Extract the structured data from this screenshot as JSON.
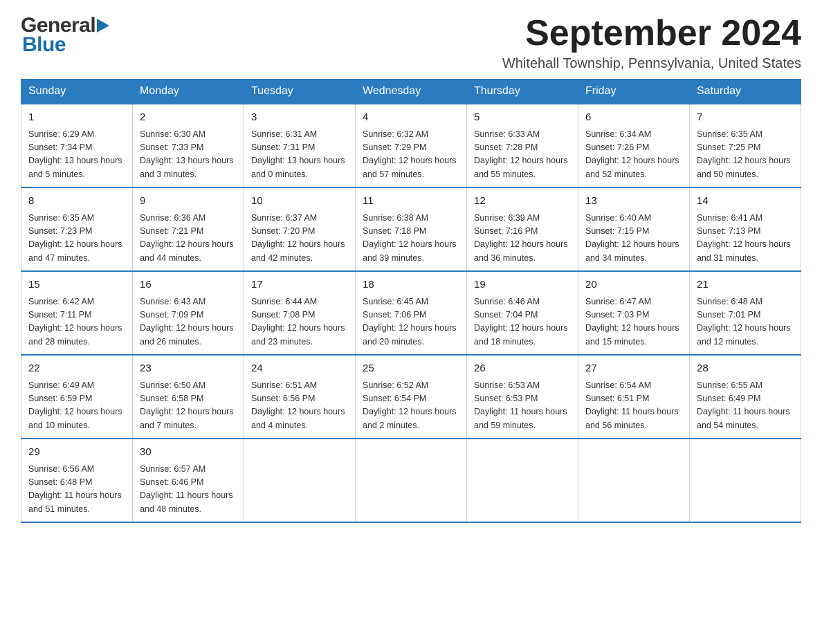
{
  "header": {
    "logo_general": "General",
    "logo_blue": "Blue",
    "month_year": "September 2024",
    "location": "Whitehall Township, Pennsylvania, United States"
  },
  "days_of_week": [
    "Sunday",
    "Monday",
    "Tuesday",
    "Wednesday",
    "Thursday",
    "Friday",
    "Saturday"
  ],
  "weeks": [
    [
      {
        "day": "1",
        "sunrise": "6:29 AM",
        "sunset": "7:34 PM",
        "daylight": "13 hours and 5 minutes."
      },
      {
        "day": "2",
        "sunrise": "6:30 AM",
        "sunset": "7:33 PM",
        "daylight": "13 hours and 3 minutes."
      },
      {
        "day": "3",
        "sunrise": "6:31 AM",
        "sunset": "7:31 PM",
        "daylight": "13 hours and 0 minutes."
      },
      {
        "day": "4",
        "sunrise": "6:32 AM",
        "sunset": "7:29 PM",
        "daylight": "12 hours and 57 minutes."
      },
      {
        "day": "5",
        "sunrise": "6:33 AM",
        "sunset": "7:28 PM",
        "daylight": "12 hours and 55 minutes."
      },
      {
        "day": "6",
        "sunrise": "6:34 AM",
        "sunset": "7:26 PM",
        "daylight": "12 hours and 52 minutes."
      },
      {
        "day": "7",
        "sunrise": "6:35 AM",
        "sunset": "7:25 PM",
        "daylight": "12 hours and 50 minutes."
      }
    ],
    [
      {
        "day": "8",
        "sunrise": "6:35 AM",
        "sunset": "7:23 PM",
        "daylight": "12 hours and 47 minutes."
      },
      {
        "day": "9",
        "sunrise": "6:36 AM",
        "sunset": "7:21 PM",
        "daylight": "12 hours and 44 minutes."
      },
      {
        "day": "10",
        "sunrise": "6:37 AM",
        "sunset": "7:20 PM",
        "daylight": "12 hours and 42 minutes."
      },
      {
        "day": "11",
        "sunrise": "6:38 AM",
        "sunset": "7:18 PM",
        "daylight": "12 hours and 39 minutes."
      },
      {
        "day": "12",
        "sunrise": "6:39 AM",
        "sunset": "7:16 PM",
        "daylight": "12 hours and 36 minutes."
      },
      {
        "day": "13",
        "sunrise": "6:40 AM",
        "sunset": "7:15 PM",
        "daylight": "12 hours and 34 minutes."
      },
      {
        "day": "14",
        "sunrise": "6:41 AM",
        "sunset": "7:13 PM",
        "daylight": "12 hours and 31 minutes."
      }
    ],
    [
      {
        "day": "15",
        "sunrise": "6:42 AM",
        "sunset": "7:11 PM",
        "daylight": "12 hours and 28 minutes."
      },
      {
        "day": "16",
        "sunrise": "6:43 AM",
        "sunset": "7:09 PM",
        "daylight": "12 hours and 26 minutes."
      },
      {
        "day": "17",
        "sunrise": "6:44 AM",
        "sunset": "7:08 PM",
        "daylight": "12 hours and 23 minutes."
      },
      {
        "day": "18",
        "sunrise": "6:45 AM",
        "sunset": "7:06 PM",
        "daylight": "12 hours and 20 minutes."
      },
      {
        "day": "19",
        "sunrise": "6:46 AM",
        "sunset": "7:04 PM",
        "daylight": "12 hours and 18 minutes."
      },
      {
        "day": "20",
        "sunrise": "6:47 AM",
        "sunset": "7:03 PM",
        "daylight": "12 hours and 15 minutes."
      },
      {
        "day": "21",
        "sunrise": "6:48 AM",
        "sunset": "7:01 PM",
        "daylight": "12 hours and 12 minutes."
      }
    ],
    [
      {
        "day": "22",
        "sunrise": "6:49 AM",
        "sunset": "6:59 PM",
        "daylight": "12 hours and 10 minutes."
      },
      {
        "day": "23",
        "sunrise": "6:50 AM",
        "sunset": "6:58 PM",
        "daylight": "12 hours and 7 minutes."
      },
      {
        "day": "24",
        "sunrise": "6:51 AM",
        "sunset": "6:56 PM",
        "daylight": "12 hours and 4 minutes."
      },
      {
        "day": "25",
        "sunrise": "6:52 AM",
        "sunset": "6:54 PM",
        "daylight": "12 hours and 2 minutes."
      },
      {
        "day": "26",
        "sunrise": "6:53 AM",
        "sunset": "6:53 PM",
        "daylight": "11 hours and 59 minutes."
      },
      {
        "day": "27",
        "sunrise": "6:54 AM",
        "sunset": "6:51 PM",
        "daylight": "11 hours and 56 minutes."
      },
      {
        "day": "28",
        "sunrise": "6:55 AM",
        "sunset": "6:49 PM",
        "daylight": "11 hours and 54 minutes."
      }
    ],
    [
      {
        "day": "29",
        "sunrise": "6:56 AM",
        "sunset": "6:48 PM",
        "daylight": "11 hours and 51 minutes."
      },
      {
        "day": "30",
        "sunrise": "6:57 AM",
        "sunset": "6:46 PM",
        "daylight": "11 hours and 48 minutes."
      },
      null,
      null,
      null,
      null,
      null
    ]
  ],
  "labels": {
    "sunrise": "Sunrise:",
    "sunset": "Sunset:",
    "daylight": "Daylight:"
  }
}
